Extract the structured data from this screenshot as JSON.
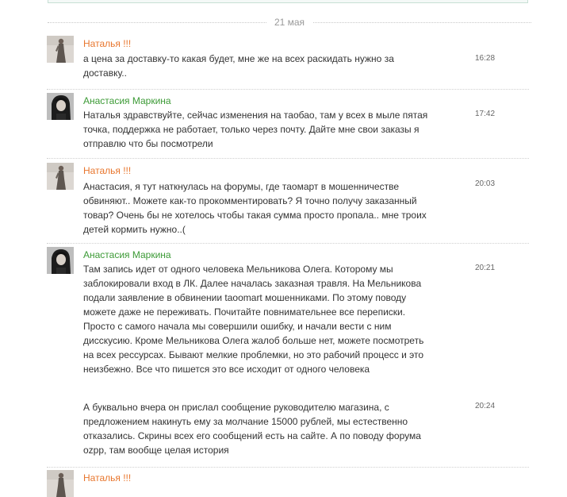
{
  "date_separator": "21 мая",
  "messages": [
    {
      "author": "Наталья !!!",
      "author_color": "#e8762d",
      "avatar": "natalya-avatar",
      "time": "16:28",
      "paragraphs": [
        {
          "text": "а цена за доставку-то какая будет, мне же на всех раскидать нужно за доставку..",
          "time": "16:28"
        }
      ]
    },
    {
      "author": "Анастасия Маркина",
      "author_color": "#3c9a36",
      "avatar": "anastasia-avatar",
      "paragraphs": [
        {
          "text": "Наталья здравствуйте, сейчас изменения на таобао, там  у всех в мыле пятая точка, поддержка не работает, только через почту. Дайте мне свои заказы я отправлю что бы посмотрели",
          "time": "17:42"
        }
      ]
    },
    {
      "author": "Наталья !!!",
      "author_color": "#e8762d",
      "avatar": "natalya-avatar",
      "paragraphs": [
        {
          "text": "Анастасия, я тут наткнулась на форумы, где таомарт в мошенничестве обвиняют.. Можете как-то прокомментировать? Я точно получу заказанный товар? Очень бы не хотелось чтобы такая сумма просто пропала.. мне троих детей кормить нужно..(",
          "time": "20:03"
        }
      ]
    },
    {
      "author": "Анастасия Маркина",
      "author_color": "#3c9a36",
      "avatar": "anastasia-avatar",
      "paragraphs": [
        {
          "text": "Там запись идет от одного человека Мельникова Олега. Которому мы заблокировали вход в ЛК. Далее началась заказная травля. На Мельникова подали заявление в обвинении taoomart мошенниками. По этому поводу можете даже не переживать. Почитайте повнимательнее все переписки. Просто с самого начала мы совершили ошибку, и начали вести с ним дисскусию. Кроме Мельникова Олега жалоб больше нет, можете посмотреть на всех ресcурсах. Бывают мелкие проблемки, но это рабочий процесс и это неизбежно. Все что пишется это все исходит от одного человека",
          "time": "20:21"
        },
        {
          "text": "А буквально вчера он прислал сообщение руководителю магазина, с предложением накинуть ему за молчание 15000 рублей, мы естественно отказались. Скрины всех его сообщений есть на сайте. А по поводу форума ozpp, там вообще целая история",
          "time": "20:24"
        }
      ]
    },
    {
      "author": "Наталья !!!",
      "author_color": "#e8762d",
      "avatar": "natalya-avatar",
      "paragraphs": []
    }
  ]
}
